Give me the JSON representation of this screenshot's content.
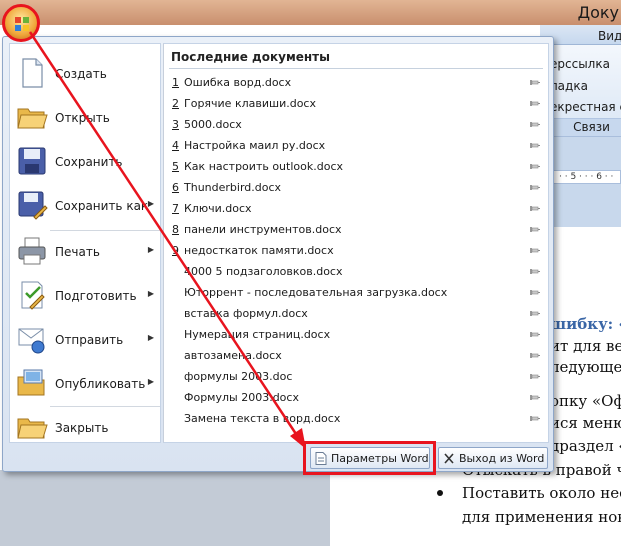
{
  "window": {
    "title": "Доку"
  },
  "ribbon": {
    "tab_view": "Вид",
    "items": [
      "ерссылка",
      "ладка",
      "екрестная сс"
    ],
    "group_label": "Связи",
    "ruler_text": "· · 5 · · · 6 · ·"
  },
  "document": {
    "heading": "шибку: «",
    "lines": [
      "ит для вер",
      "ледующе",
      "опку «Оф",
      "ися меню",
      "драздел «",
      "Отыскать в правой час"
    ],
    "bullets": [
      "Поставить около неё о",
      "для применения новой"
    ]
  },
  "office_menu": {
    "commands": [
      {
        "label": "Создать",
        "icon": "new-document-icon",
        "has_submenu": false
      },
      {
        "label": "Открыть",
        "icon": "open-folder-icon",
        "has_submenu": false
      },
      {
        "label": "Сохранить",
        "icon": "save-disk-icon",
        "has_submenu": false
      },
      {
        "label": "Сохранить как",
        "icon": "save-as-icon",
        "has_submenu": true
      },
      {
        "label": "Печать",
        "icon": "printer-icon",
        "has_submenu": true
      },
      {
        "label": "Подготовить",
        "icon": "prepare-icon",
        "has_submenu": true
      },
      {
        "label": "Отправить",
        "icon": "send-icon",
        "has_submenu": true
      },
      {
        "label": "Опубликовать",
        "icon": "publish-icon",
        "has_submenu": true
      },
      {
        "label": "Закрыть",
        "icon": "close-document-icon",
        "has_submenu": false
      }
    ],
    "recent_title": "Последние документы",
    "recent_docs": [
      {
        "num": "1",
        "name": "Ошибка ворд.docx"
      },
      {
        "num": "2",
        "name": "Горячие клавиши.docx"
      },
      {
        "num": "3",
        "name": "5000.docx"
      },
      {
        "num": "4",
        "name": "Настройка маил ру.docx"
      },
      {
        "num": "5",
        "name": "Как настроить outlook.docx"
      },
      {
        "num": "6",
        "name": "Thunderbird.docx"
      },
      {
        "num": "7",
        "name": "Ключи.docx"
      },
      {
        "num": "8",
        "name": "панели инструментов.docx"
      },
      {
        "num": "9",
        "name": "недосткаток памяти.docx"
      },
      {
        "num": "",
        "name": "4000 5 подзаголовков.docx"
      },
      {
        "num": "",
        "name": "Ютоppeнт - последовательная загрузка.docx"
      },
      {
        "num": "",
        "name": "вставка формул.docx"
      },
      {
        "num": "",
        "name": "Нумерация страниц.docx"
      },
      {
        "num": "",
        "name": "автозамена.docx"
      },
      {
        "num": "",
        "name": "формулы 2003.doc"
      },
      {
        "num": "",
        "name": "Формулы 2003.docx"
      },
      {
        "num": "",
        "name": "Замена текста в ворд.docx"
      }
    ],
    "options_button": "Параметры Word",
    "exit_button": "Выход из Word"
  },
  "colors": {
    "highlight": "#e8141e",
    "menu_bg": "#dfe8f4",
    "accent": "#3a66a6"
  }
}
